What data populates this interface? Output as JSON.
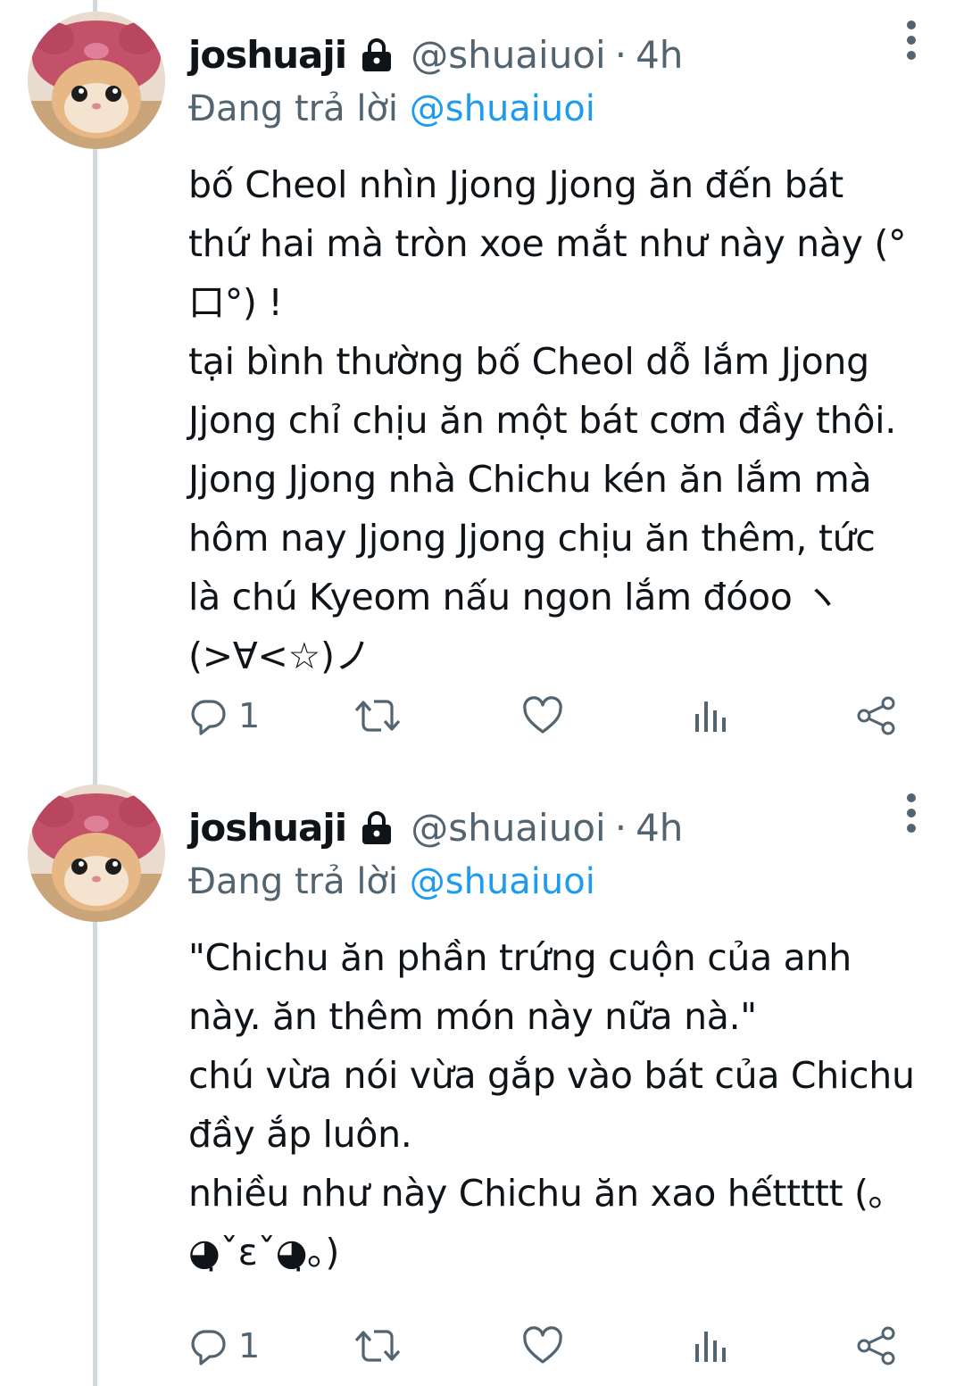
{
  "tweets": [
    {
      "display_name": "joshuaji",
      "handle": "@shuaiuoi",
      "separator": "·",
      "time": "4h",
      "reply_prefix": "Đang trả lời",
      "reply_to": "@shuaiuoi",
      "text": "bố Cheol nhìn Jjong Jjong ăn đến bát\nthứ hai mà tròn xoe mắt như này này (°\n口°) !\ntại bình thường bố Cheol dỗ lắm Jjong\nJjong chỉ chịu ăn một bát cơm đầy thôi.\nJjong Jjong nhà Chichu kén ăn lắm mà\nhôm nay Jjong Jjong chịu ăn thêm, tức\nlà chú Kyeom nấu ngon lắm đóoo ヽ\n(>∀<☆)ノ",
      "reply_count": "1"
    },
    {
      "display_name": "joshuaji",
      "handle": "@shuaiuoi",
      "separator": "·",
      "time": "4h",
      "reply_prefix": "Đang trả lời",
      "reply_to": "@shuaiuoi",
      "text": "\"Chichu ăn phần trứng cuộn của anh\nnày. ăn thêm món này nữa nà.\"\nchú vừa nói vừa gắp vào bát của Chichu\nđầy ắp luôn.\nnhiều như này Chichu ăn xao hếttttt (｡\n◕̣ˇɛˇ◕̣｡)",
      "reply_count": "1"
    }
  ],
  "icons": {
    "lock": "lock-icon",
    "more": "more-vertical-icon",
    "reply": "reply-icon",
    "retweet": "retweet-icon",
    "like": "heart-icon",
    "views": "analytics-icon",
    "share": "share-icon"
  },
  "colors": {
    "text": "#0f1419",
    "muted": "#536471",
    "link": "#1d9bf0",
    "thread_line": "#cfd9de"
  }
}
